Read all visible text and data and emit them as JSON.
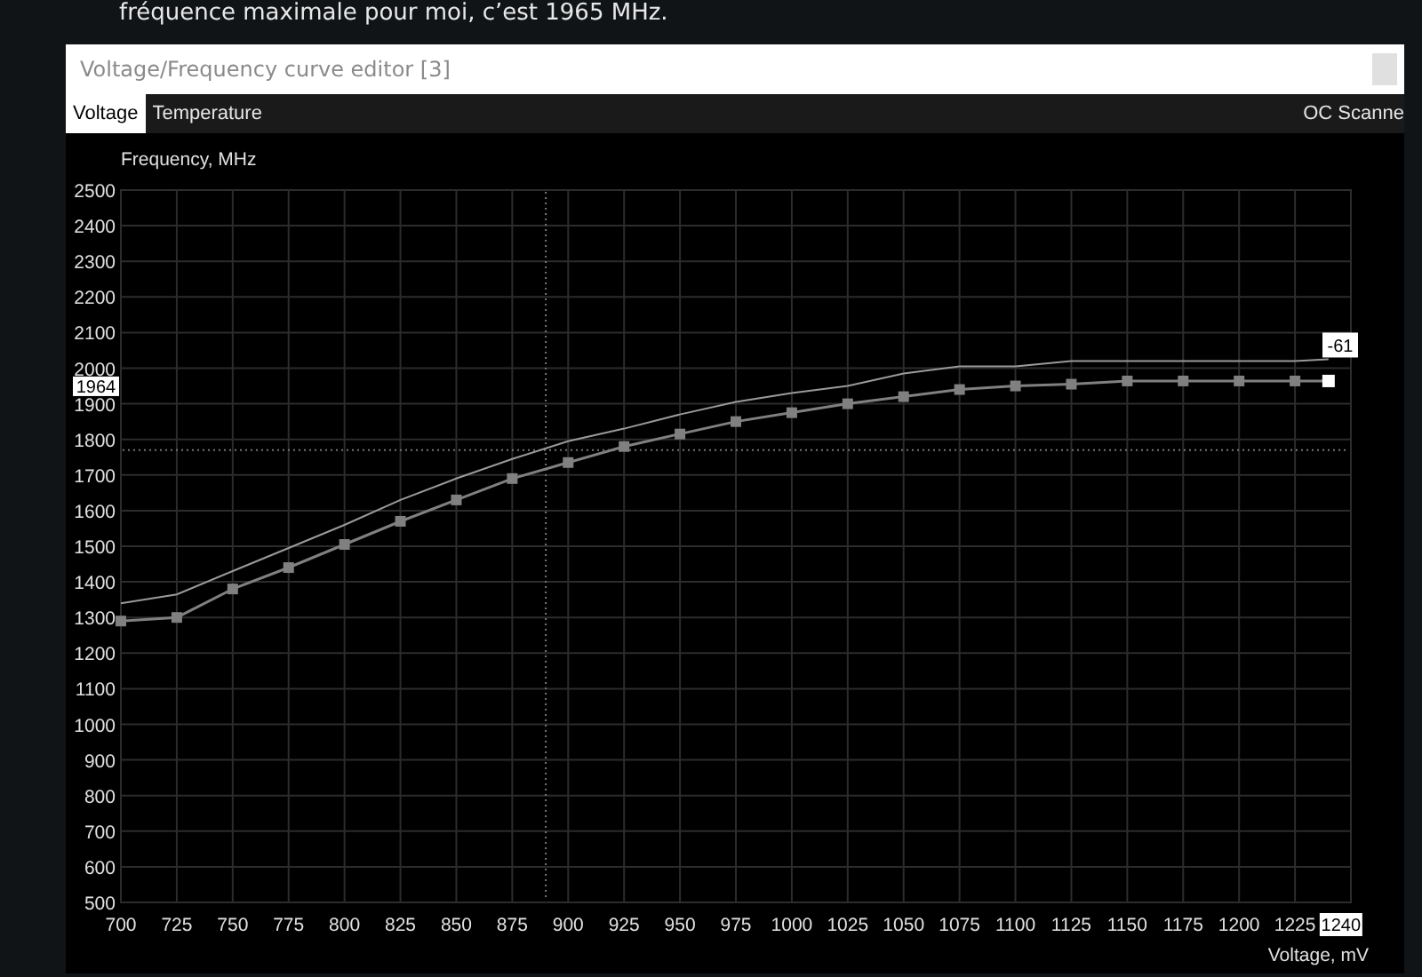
{
  "article": {
    "text": "fréquence maximale pour moi, c’est 1965 MHz."
  },
  "window": {
    "title": "Voltage/Frequency curve editor [3]"
  },
  "tabs": [
    {
      "label": "Voltage",
      "selected": true
    },
    {
      "label": "Temperature",
      "selected": false
    }
  ],
  "oc_scanner": {
    "label": "OC Scanne"
  },
  "chart_data": {
    "type": "line",
    "ylabel": "Frequency, MHz",
    "xlabel": "Voltage, mV",
    "grid": true,
    "x": [
      700,
      725,
      750,
      775,
      800,
      825,
      850,
      875,
      900,
      925,
      950,
      975,
      1000,
      1025,
      1050,
      1075,
      1100,
      1125,
      1150,
      1175,
      1200,
      1225,
      1240
    ],
    "series": [
      {
        "color": "#9a9a9a",
        "values": [
          1340,
          1365,
          1430,
          1495,
          1560,
          1630,
          1690,
          1745,
          1795,
          1830,
          1870,
          1905,
          1930,
          1950,
          1985,
          2005,
          2005,
          2020,
          2020,
          2020,
          2020,
          2020,
          2025
        ]
      },
      {
        "color": "#808080",
        "marker": "square",
        "values": [
          1290,
          1300,
          1380,
          1440,
          1505,
          1570,
          1630,
          1690,
          1735,
          1780,
          1815,
          1850,
          1875,
          1900,
          1920,
          1940,
          1950,
          1955,
          1964,
          1964,
          1964,
          1964,
          1964
        ]
      }
    ],
    "xlim": [
      700,
      1250
    ],
    "ylim": [
      500,
      2500
    ],
    "xticks": [
      700,
      725,
      750,
      775,
      800,
      825,
      850,
      875,
      900,
      925,
      950,
      975,
      1000,
      1025,
      1050,
      1075,
      1100,
      1125,
      1150,
      1175,
      1200,
      1225
    ],
    "yticks": [
      500,
      600,
      700,
      800,
      900,
      1000,
      1100,
      1200,
      1300,
      1400,
      1500,
      1600,
      1700,
      1800,
      1900,
      2000,
      2100,
      2200,
      2300,
      2400,
      2500
    ],
    "ref_lines": [
      {
        "axis": "x",
        "value": 890
      },
      {
        "axis": "y",
        "value": 1770
      }
    ]
  },
  "markers": [
    {
      "kind": "frequency",
      "label": "1964"
    },
    {
      "kind": "offset",
      "label": "-61"
    },
    {
      "kind": "voltage",
      "label": "1240"
    }
  ]
}
